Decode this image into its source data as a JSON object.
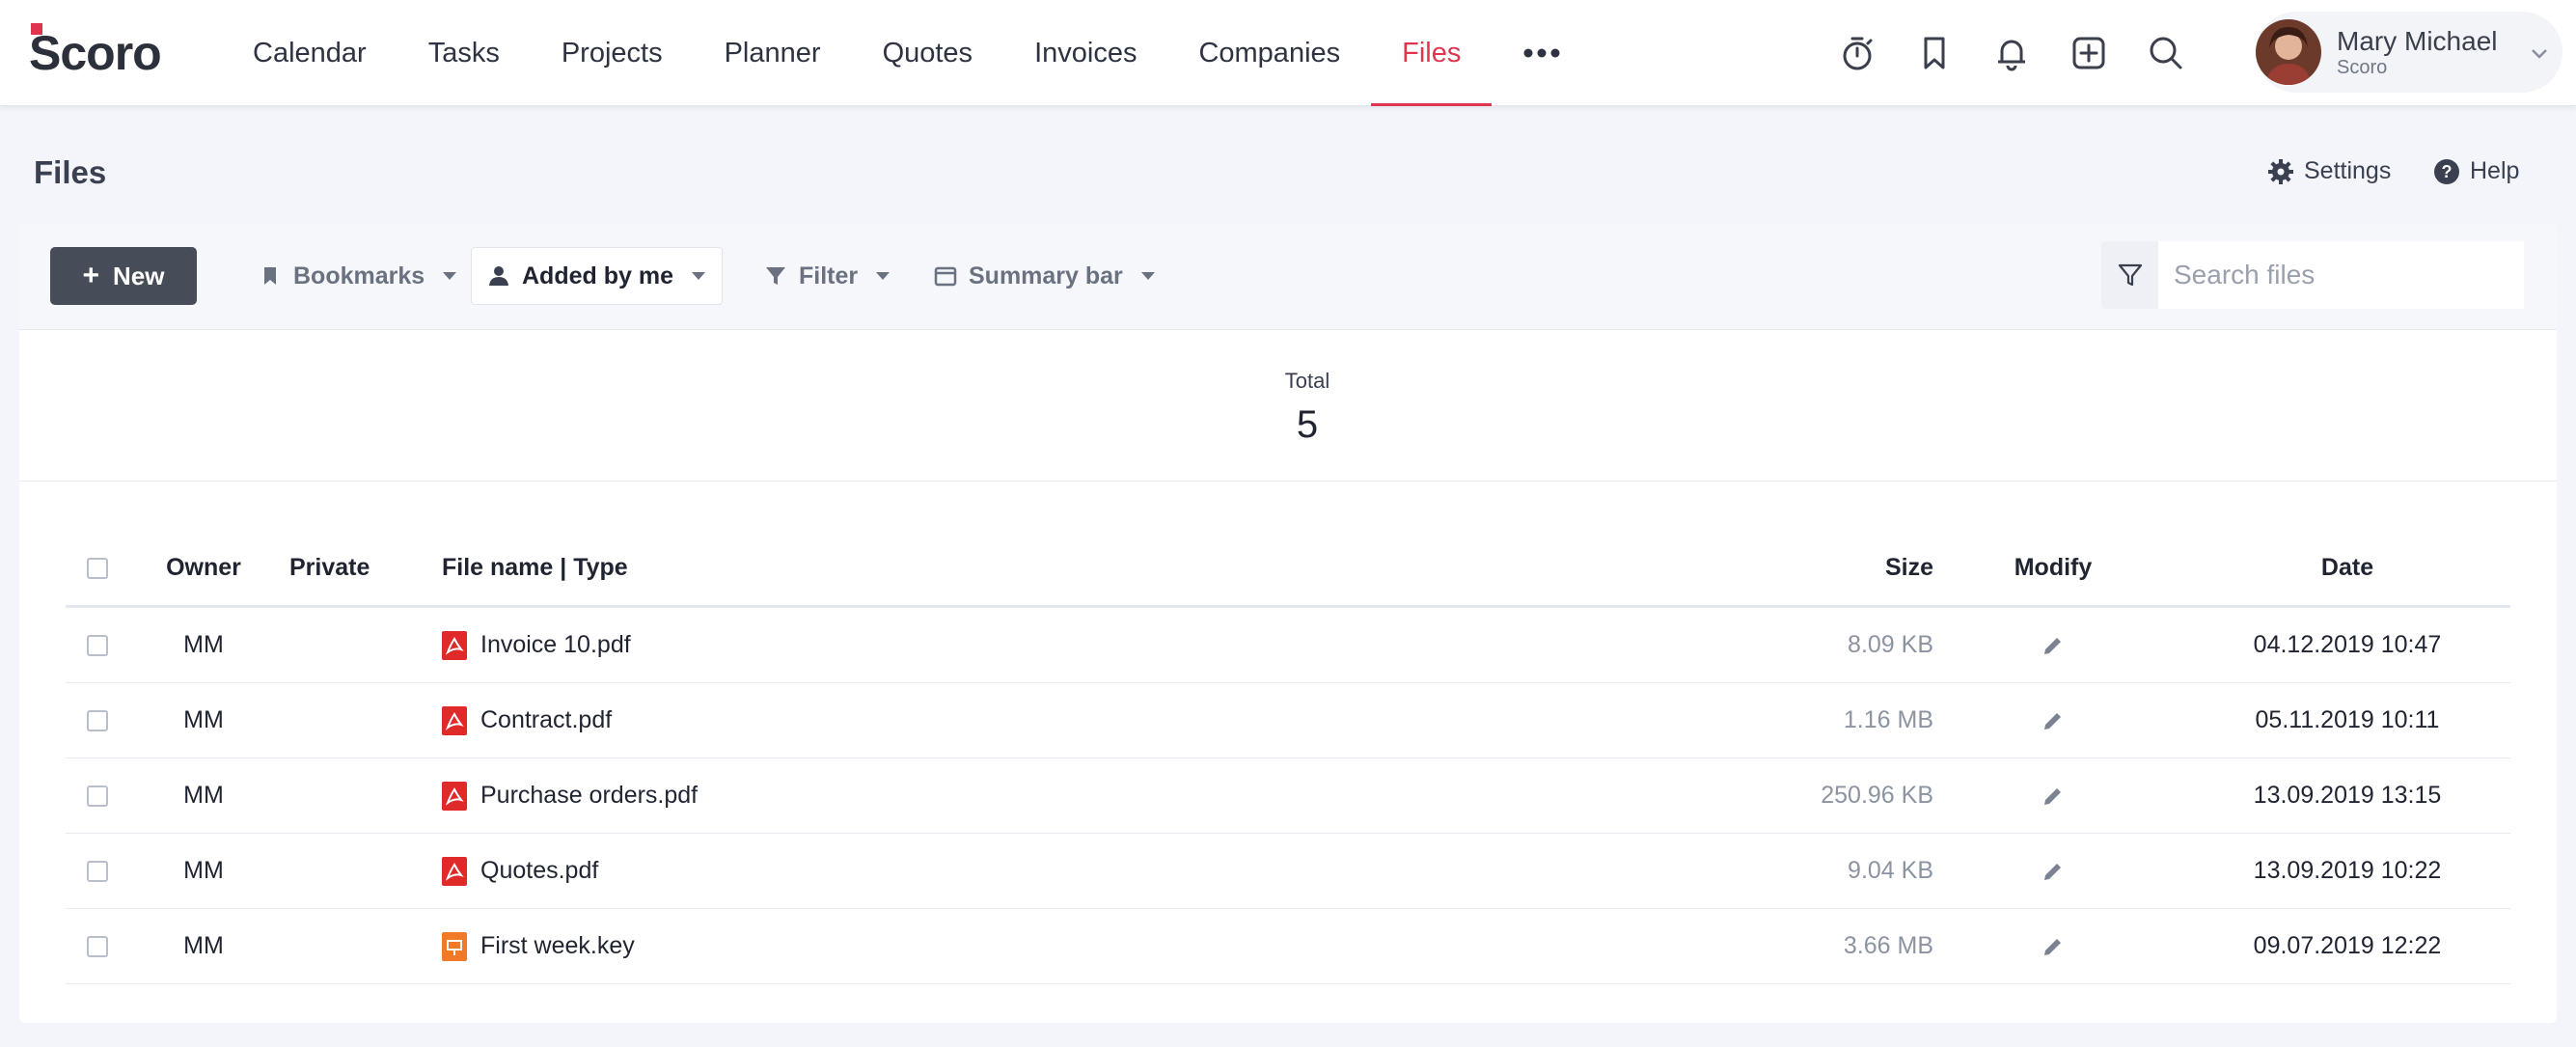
{
  "app": {
    "logo_text": "Scoro",
    "brand_color": "#e0354f"
  },
  "nav": {
    "items": [
      {
        "label": "Calendar"
      },
      {
        "label": "Tasks"
      },
      {
        "label": "Projects"
      },
      {
        "label": "Planner"
      },
      {
        "label": "Quotes"
      },
      {
        "label": "Invoices"
      },
      {
        "label": "Companies"
      },
      {
        "label": "Files",
        "active": true
      }
    ],
    "more_icon": "more-horizontal-icon"
  },
  "top_icons": [
    "timer-icon",
    "bookmark-icon",
    "bell-icon",
    "add-box-icon",
    "search-icon"
  ],
  "user": {
    "name": "Mary Michael",
    "company": "Scoro"
  },
  "page": {
    "title": "Files",
    "settings_label": "Settings",
    "help_label": "Help"
  },
  "toolbar": {
    "new_label": "New",
    "bookmarks_label": "Bookmarks",
    "added_by_me_label": "Added by me",
    "filter_label": "Filter",
    "summary_bar_label": "Summary bar",
    "search_placeholder": "Search files"
  },
  "summary": {
    "total_label": "Total",
    "total_value": "5"
  },
  "table": {
    "headers": {
      "owner": "Owner",
      "private": "Private",
      "file_name": "File name | Type",
      "size": "Size",
      "modify": "Modify",
      "date": "Date"
    },
    "rows": [
      {
        "owner": "MM",
        "name": "Invoice 10.pdf",
        "type": "pdf",
        "size": "8.09 KB",
        "date": "04.12.2019 10:47"
      },
      {
        "owner": "MM",
        "name": "Contract.pdf",
        "type": "pdf",
        "size": "1.16 MB",
        "date": "05.11.2019 10:11"
      },
      {
        "owner": "MM",
        "name": "Purchase orders.pdf",
        "type": "pdf",
        "size": "250.96 KB",
        "date": "13.09.2019 13:15"
      },
      {
        "owner": "MM",
        "name": "Quotes.pdf",
        "type": "pdf",
        "size": "9.04 KB",
        "date": "13.09.2019 10:22"
      },
      {
        "owner": "MM",
        "name": "First week.key",
        "type": "key",
        "size": "3.66 MB",
        "date": "09.07.2019 12:22"
      }
    ]
  }
}
